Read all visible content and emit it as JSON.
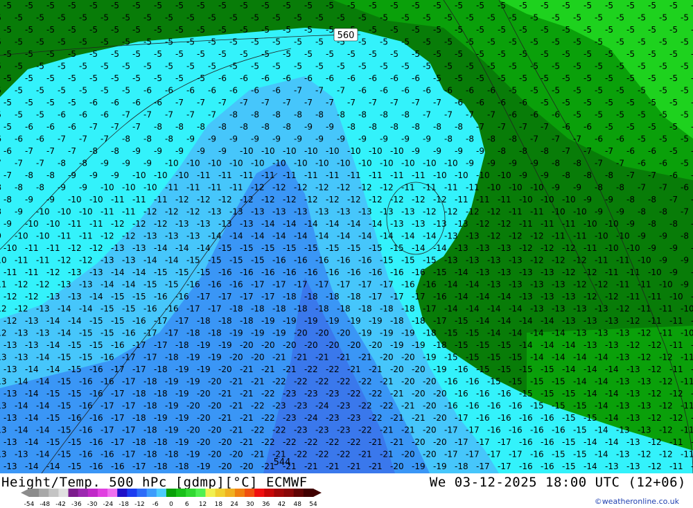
{
  "map": {
    "contour_label": "560",
    "contour_label_bottom": "544",
    "band_colors": {
      "dark_green": "#087c08",
      "mid_green": "#0aa00a",
      "light_green": "#1ed21e",
      "cyan": "#33f2fb",
      "sky": "#46c6fb",
      "blue1": "#3a96f6",
      "blue2": "#3a78ec"
    }
  },
  "footer": {
    "title": "Height/Temp. 500 hPc [gdmp][°C] ECMWF",
    "datetime": "We 03-12-2025 18:00 UTC (12+06)",
    "copyright": "©weatheronline.co.uk",
    "scale_ticks": [
      "-54",
      "-48",
      "-42",
      "-36",
      "-30",
      "-24",
      "-18",
      "-12",
      "-6",
      "0",
      "6",
      "12",
      "18",
      "24",
      "30",
      "36",
      "42",
      "48",
      "54"
    ],
    "scale_colors": [
      "#8c8c8c",
      "#a8a8a8",
      "#c4c4c4",
      "#e0e0e0",
      "#7c1c8c",
      "#9c28b0",
      "#c028c8",
      "#e040e0",
      "#f070f0",
      "#2010c8",
      "#1c3cf0",
      "#2c6cf8",
      "#3c9cfc",
      "#4cccfc",
      "#08a008",
      "#18c018",
      "#30d830",
      "#50f050",
      "#f0f050",
      "#f0d030",
      "#f0b020",
      "#f08010",
      "#f05010",
      "#f01010",
      "#c80808",
      "#a00808",
      "#880808",
      "#600404",
      "#400000"
    ]
  }
}
